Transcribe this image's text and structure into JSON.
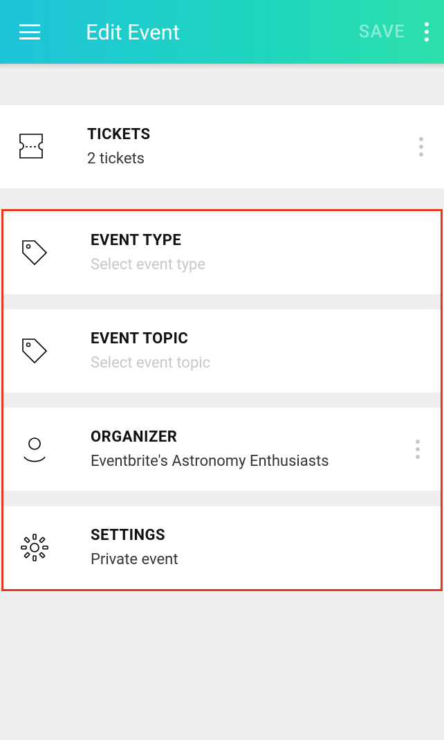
{
  "header": {
    "title": "Edit Event",
    "save_label": "SAVE"
  },
  "cards": {
    "tickets": {
      "title": "TICKETS",
      "subtitle": "2 tickets"
    },
    "event_type": {
      "title": "EVENT TYPE",
      "subtitle": "Select event type"
    },
    "event_topic": {
      "title": "EVENT TOPIC",
      "subtitle": "Select event topic"
    },
    "organizer": {
      "title": "ORGANIZER",
      "subtitle": "Eventbrite's Astronomy Enthusiasts"
    },
    "settings": {
      "title": "SETTINGS",
      "subtitle": "Private event"
    }
  }
}
